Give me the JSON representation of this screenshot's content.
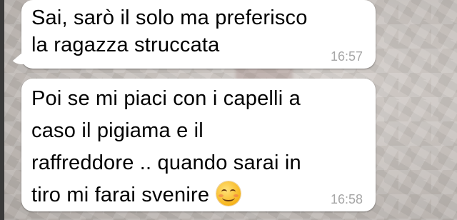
{
  "messages": [
    {
      "text": "Sai, sarò il solo ma preferisco\nla ragazza struccata",
      "time": "16:57"
    },
    {
      "text": "Poi se mi piaci con i capelli a\ncaso il pigiama e il\nraffreddore .. quando sarai in\ntiro mi farai svenire",
      "time": "16:58",
      "emoji": "smiling-face-icon"
    }
  ],
  "colors": {
    "bubble": "#ffffff",
    "timestamp": "#a6a6a6",
    "wallpaper": "#c7c0bb"
  }
}
